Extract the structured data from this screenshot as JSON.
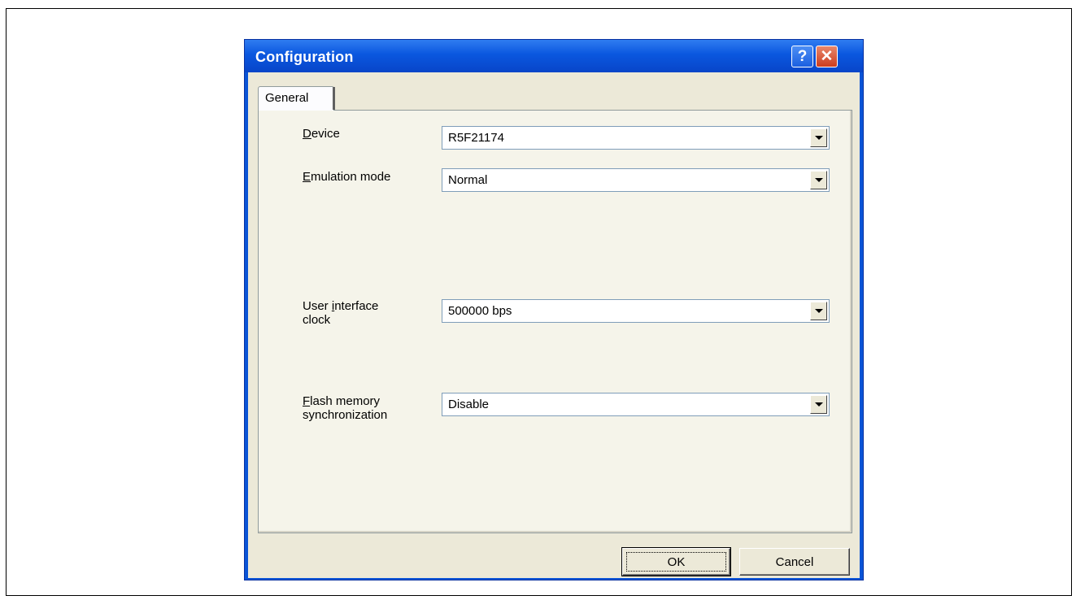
{
  "dialog": {
    "title": "Configuration",
    "help_symbol": "?",
    "close_symbol": "✕"
  },
  "tabs": [
    {
      "label": "General",
      "selected": true
    }
  ],
  "fields": [
    {
      "label_mnemonic": "D",
      "label_rest": "evice",
      "value": "R5F21174"
    },
    {
      "label_mnemonic": "E",
      "label_rest": "mulation mode",
      "value": "Normal"
    },
    {
      "label_line1_pre": "User ",
      "label_mnemonic": "i",
      "label_line1_post": "nterface",
      "label_line2": "clock",
      "value": "500000 bps"
    },
    {
      "label_mnemonic": "F",
      "label_line1_post": "lash memory",
      "label_line2": "synchronization",
      "value": "Disable"
    }
  ],
  "buttons": {
    "ok_label": "OK",
    "cancel_label": "Cancel"
  },
  "colors": {
    "titlebar": "#0a54d6",
    "close_button": "#cc3d1e",
    "dialog_face": "#ece9d8"
  },
  "icons": [
    "help-icon",
    "close-icon",
    "dropdown-arrow-icon"
  ]
}
